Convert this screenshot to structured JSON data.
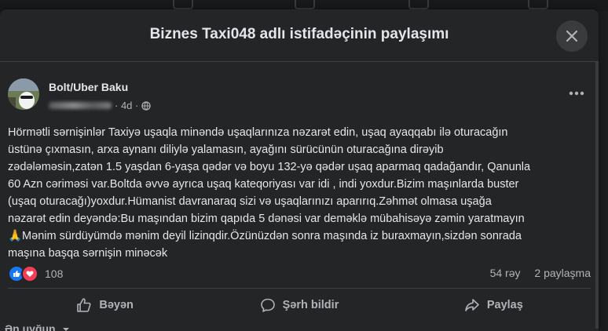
{
  "dialog": {
    "title": "Biznes Taxi048 adlı istifadəçinin paylaşımı"
  },
  "post": {
    "author": "Bolt/Uber Baku",
    "time": "4d",
    "text": "Hörmətli sərnişinlər  Taxiyə uşaqla minəndə uşaqlarınıza nəzarət edin, uşaq ayaqqabı ilə oturacağın\nüstünə çıxmasın, arxa aynanı diliylə yalamasın, ayağını sürücünün  oturacağına dirəyib\nzədələməsin,zatən 1.5 yaşdan 6-yaşa qədər və boyu 132-yə qədər uşaq aparmaq qadağandır, Qanunla\n60 Azn cəriməsi var.Boltda əvvə ayrıca uşaq kateqoriyası var idi , indi yoxdur.Bizim maşınlarda buster\n(uşaq oturacağı)yoxdur.Hümanist davranaraq sizi və uşaqlarınızı aparırıq.Zəhmət olmasa uşağa\nnəzarət edin deyəndə:Bu maşından bizim qapıda 5 dənəsi var deməklə mübahisəyə zəmin yaratmayın\n🙏Mənim sürdüyümdə mənim deyil lizinqdir.Özünüzdən sonra maşında iz buraxmayın,sizdən sonrada\nmaşına başqa sərnişin minəcək",
    "reaction_count": "108",
    "comments": "54 rəy",
    "shares": "2 paylaşma"
  },
  "actions": {
    "like": "Bəyən",
    "comment": "Şərh bildir",
    "share": "Paylaş"
  },
  "comments_sort": "Ən uyğun",
  "colors": {
    "like_blue": "#1877f2",
    "love_red": "#f33e58",
    "surface": "#242526"
  }
}
